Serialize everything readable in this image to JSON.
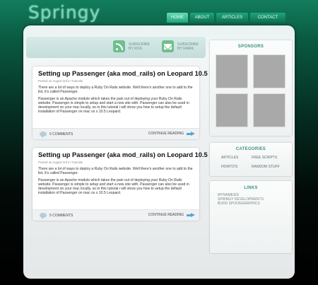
{
  "logo": "Springy",
  "nav": [
    "HOME",
    "ABOUT",
    "ARTICLES",
    "CONTACT"
  ],
  "subscribe": {
    "rss": [
      "SUBSCRIBE",
      "BY RSS"
    ],
    "email": [
      "SUBSCRIBE",
      "BY EMAIL"
    ]
  },
  "posts": [
    {
      "title": "Setting up Passenger (aka mod_rails) on Leopard 10.5",
      "meta": "Posted on August 3rd in Tutorials",
      "paras": [
        "There are a lot of ways to deploy a Ruby On Rails website. Well there's another one to add to the list, it's called Passenger.",
        "Passenger is an Apache module which takes the pain out of deploying your Ruby On Rails website. Passenger is simple to setup and start a new site with. Passenger can also be used in development on your mac locally, so in this tutorial i will show you how to setup the default installation of Passenger on mac os x 10.5 Leopard."
      ],
      "comments": "5 COMMENTS",
      "continue": "CONTINUE READING"
    },
    {
      "title": "Setting up Passenger (aka mod_rails) on Leopard 10.5",
      "meta": "Posted on August 3rd in Tutorials",
      "paras": [
        "There are a lot of ways to deploy a Ruby On Rails website. Well there's another one to add to the list, it's called Passenger.",
        "Passenger is an Apache module which takes the pain out of deploying your Ruby On Rails website. Passenger is simple to setup and start a new site with. Passenger can also be used in development on your mac locally, so in this tutorial i will show you how to setup the default installation of Passenger on mac os x 10.5 Leopard."
      ],
      "comments": "5 COMMENTS",
      "continue": "CONTINUE READING"
    }
  ],
  "sponsors": {
    "title": "SPONSORS"
  },
  "categories": {
    "title": "CATEGORIES",
    "items": [
      "ARTICLES",
      "FREE SCRIPTS",
      "HOWTO'S",
      "RANDOM STUFF"
    ]
  },
  "links": {
    "title": "LINKS",
    "items": [
      "MYNAMESIS",
      "SPRINGY DEVELOPMENTS",
      "BUDD SPOONGRAPHICS"
    ]
  }
}
